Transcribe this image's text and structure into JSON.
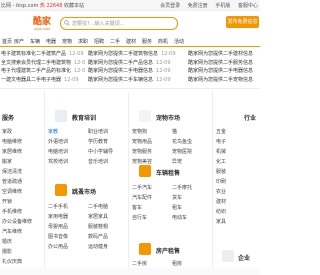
{
  "topbar": {
    "left_prefix": "比网 - iksp.com",
    "hot": "热 22648",
    "left_suffix": "收藏本站",
    "links": [
      "会员登录",
      "免费注册",
      "手机版",
      "客服中心"
    ]
  },
  "logo": {
    "main": "酷家",
    "sub": "KUJIA.COM"
  },
  "search": {
    "placeholder": "您要找?…输入关键词…"
  },
  "post_button": "发布免费信息",
  "nav": [
    "首页",
    "房产",
    "车辆",
    "电器",
    "宠物",
    "求职",
    "招聘",
    "二手",
    "建材",
    "服务",
    "商机",
    "活动"
  ],
  "ticker": {
    "col1": [
      {
        "text": "电子建筑标准化二手建筑产品",
        "date": "12-09"
      },
      {
        "text": "全文搜索会员代理二手电建筑物",
        "date": "12-09"
      },
      {
        "text": "电子代理建筑二手产品的标准化",
        "date": "12-09"
      },
      {
        "text": "一建文电器具二手电子电器",
        "date": "12-09"
      }
    ],
    "col2": [
      {
        "text": "酷家网为您提供二手建筑物信息",
        "date": "12-09"
      },
      {
        "text": "酷家网为您提供二手产品信息",
        "date": "12-09"
      },
      {
        "text": "酷家网为您提供二手电器信息",
        "date": "12-09"
      },
      {
        "text": "酷家网为您提供二手车辆信息",
        "date": "12-09"
      }
    ],
    "col3": [
      {
        "text": "酷家网为您提供二手建材信息"
      },
      {
        "text": "酷家网为您提供二手服务信息"
      },
      {
        "text": "酷家网为您提供二手电器信息"
      },
      {
        "text": "酷家网为您提供二手宠物信息"
      }
    ]
  },
  "sections": {
    "service": {
      "title": "服务",
      "links": [
        "家政",
        "电脑维修",
        "家居维修",
        "搬家",
        "保洁清洗",
        "管道疏通",
        "空调维修",
        "开锁",
        "手机维修",
        "办公设备维修",
        "汽车维修",
        "婚庆",
        "摄影",
        "礼仪庆典",
        "装修"
      ]
    },
    "education": {
      "title": "教育培训",
      "links": [
        "家教",
        "职业培训",
        "外语培训",
        "学历教育",
        "电脑培训",
        "中小学辅导",
        "驾校培训",
        "音乐培训"
      ]
    },
    "pets": {
      "title": "宠物市场",
      "links": [
        "宠物狗",
        "猫",
        "宠物用品",
        "花鸟鱼虫",
        "宠物服务",
        "宠物医院",
        "宠物美容",
        "异宠"
      ]
    },
    "industry": {
      "title": "行业",
      "links": [
        "五金",
        "电子",
        "机械",
        "化工",
        "服装",
        "印刷",
        "农业",
        "建材",
        "纺织",
        "家具"
      ]
    },
    "market": {
      "title": "跳蚤市场",
      "links": [
        "二手手机",
        "二手电脑",
        "家用电器",
        "家居家具",
        "母婴用品",
        "服装鞋帽",
        "图书音像",
        "数码产品",
        "办公用品",
        "运动健身"
      ]
    },
    "vehicle": {
      "title": "车辆租售",
      "links": [
        "二手汽车",
        "二手摩托",
        "汽车配件",
        "货车",
        "客车",
        "租车",
        "自行车",
        "电动车"
      ]
    },
    "estate": {
      "title": "房产租售",
      "links": [
        "二手房",
        "租房",
        "新房",
        "商铺",
        "写字楼",
        "厂房",
        "仓库",
        "车位"
      ]
    },
    "enterprise": {
      "title": "企业",
      "links": [
        "企业服务",
        "公司注册"
      ]
    }
  }
}
